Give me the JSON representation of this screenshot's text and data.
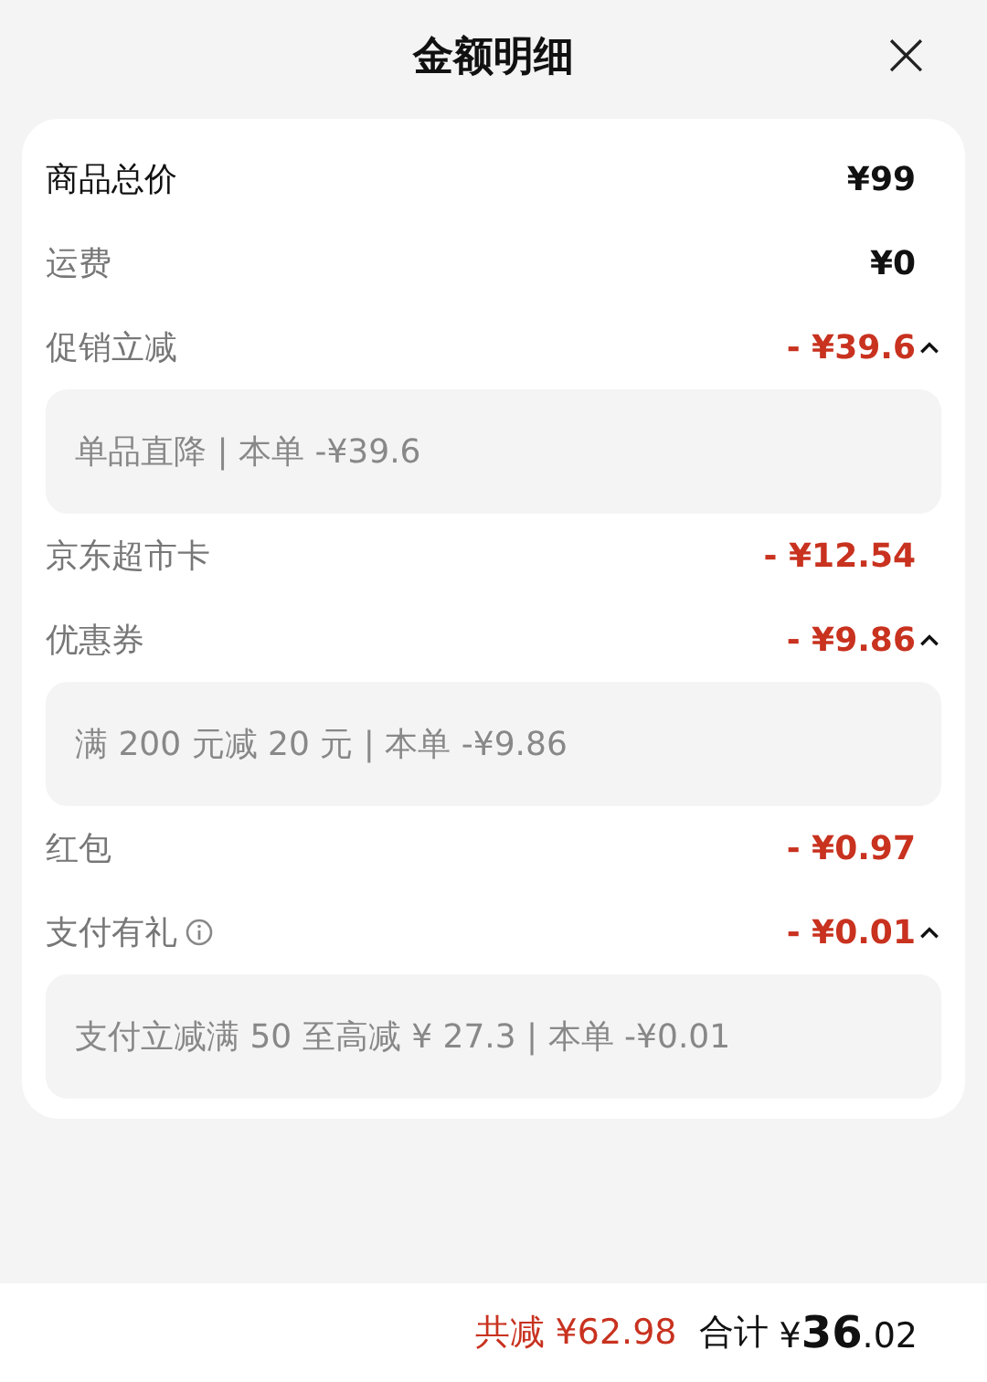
{
  "header": {
    "title": "金额明细",
    "close": "×"
  },
  "rows": [
    {
      "kind": "total",
      "label": "商品总价",
      "amount": "¥99"
    },
    {
      "kind": "fee",
      "label": "运费",
      "amount": "¥0"
    },
    {
      "kind": "discount",
      "label": "促销立减",
      "amount": "- ¥39.6",
      "expanded": true,
      "detail": "单品直降 | 本单 -¥39.6"
    },
    {
      "kind": "discount",
      "label": "京东超市卡",
      "amount": "- ¥12.54"
    },
    {
      "kind": "discount",
      "label": "优惠券",
      "amount": "- ¥9.86",
      "expanded": true,
      "detail": "满 200 元减 20 元 | 本单 -¥9.86"
    },
    {
      "kind": "discount",
      "label": "红包",
      "amount": "- ¥0.97"
    },
    {
      "kind": "discount",
      "label": "支付有礼",
      "info": true,
      "amount": "- ¥0.01",
      "expanded": true,
      "detail": "支付立减满 50 至高减 ¥ 27.3 | 本单 -¥0.01"
    }
  ],
  "footer": {
    "saved": "共减 ¥62.98",
    "total_label": "合计",
    "total": "¥**36**.02"
  }
}
